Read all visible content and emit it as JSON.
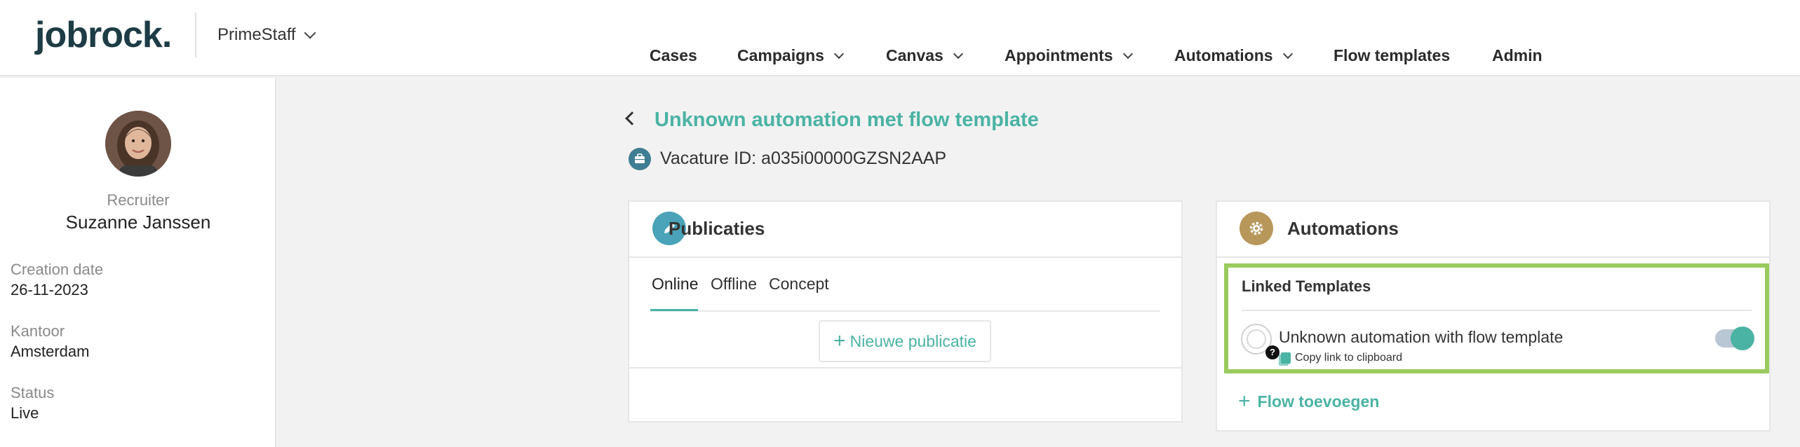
{
  "header": {
    "logo": "jobrock",
    "logo_dot": ".",
    "company": "PrimeStaff",
    "nav": [
      {
        "label": "Cases",
        "dropdown": false
      },
      {
        "label": "Campaigns",
        "dropdown": true
      },
      {
        "label": "Canvas",
        "dropdown": true
      },
      {
        "label": "Appointments",
        "dropdown": true
      },
      {
        "label": "Automations",
        "dropdown": true
      },
      {
        "label": "Flow templates",
        "dropdown": false
      },
      {
        "label": "Admin",
        "dropdown": false
      }
    ]
  },
  "sidebar": {
    "role": "Recruiter",
    "name": "Suzanne Janssen",
    "fields": [
      {
        "label": "Creation date",
        "value": "26-11-2023"
      },
      {
        "label": "Kantoor",
        "value": "Amsterdam"
      },
      {
        "label": "Status",
        "value": "Live"
      }
    ]
  },
  "main": {
    "title": "Unknown automation met flow template",
    "vacancy": "Vacature ID: a035i00000GZSN2AAP"
  },
  "publications": {
    "title": "Publicaties",
    "tabs": [
      "Online",
      "Offline",
      "Concept"
    ],
    "active_tab": "Online",
    "new_button": "Nieuwe publicatie",
    "new_plus": "+"
  },
  "automations": {
    "title": "Automations",
    "linked_title": "Linked Templates",
    "template_name": "Unknown automation with flow template",
    "copy_link": "Copy link to clipboard",
    "question_mark": "?",
    "toggle_on": true,
    "add_flow": "Flow toevoegen",
    "add_plus": "+"
  },
  "colors": {
    "accent": "#4bb3a4",
    "highlight": "#9acb5e",
    "brand_dark": "#1d3c45",
    "pub_icon": "#4aa3b8",
    "auto_icon": "#b8975a"
  }
}
